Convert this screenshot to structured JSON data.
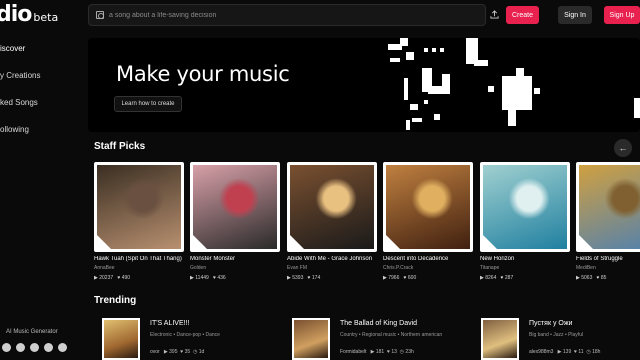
{
  "app": {
    "logo": "dio",
    "beta": "beta"
  },
  "sidebar": {
    "items": [
      {
        "label": "iscover"
      },
      {
        "label": "y Creations"
      },
      {
        "label": "ked Songs"
      },
      {
        "label": "ollowing"
      }
    ],
    "footer": "AI Music Generator",
    "socials": [
      "instagram-icon",
      "discord-icon",
      "tiktok-icon",
      "twitter-icon",
      "youtube-icon"
    ]
  },
  "topbar": {
    "search_placeholder": "a song about a life-saving decision",
    "create": "Create",
    "signin": "Sign In",
    "signup": "Sign Up"
  },
  "hero": {
    "title": "Make your music",
    "button": "Learn how to create"
  },
  "staff_picks": {
    "title": "Staff Picks",
    "cards": [
      {
        "title": "Hawk Tuah (Spit On That Thang)",
        "artist": "AnnaBee",
        "plays": "20237",
        "likes": "490",
        "colors": [
          "#3a2e22",
          "#b89070",
          "#6a5040"
        ]
      },
      {
        "title": "Monster Monster",
        "artist": "Golden",
        "plays": "11449",
        "likes": "436",
        "colors": [
          "#d8a0a8",
          "#2a2a2a",
          "#c04050"
        ]
      },
      {
        "title": "Abide With Me - Grace Johnson",
        "artist": "Evan FM",
        "plays": "5393",
        "likes": "174",
        "colors": [
          "#7a5030",
          "#1a1a1a",
          "#e8c080"
        ]
      },
      {
        "title": "Descent into Decadence",
        "artist": "Chris.P.Crack",
        "plays": "7966",
        "likes": "600",
        "colors": [
          "#c08040",
          "#402010",
          "#e0b060"
        ]
      },
      {
        "title": "New Horizon",
        "artist": "Titanape",
        "plays": "8264",
        "likes": "287",
        "colors": [
          "#a0d0d0",
          "#2080a0",
          "#e0f0f0"
        ]
      },
      {
        "title": "Fields of Struggle",
        "artist": "MediBen",
        "plays": "5063",
        "likes": "85",
        "colors": [
          "#d0a040",
          "#5080b0",
          "#806030"
        ]
      }
    ]
  },
  "trending": {
    "title": "Trending",
    "items": [
      {
        "title": "IT'S ALIVE!!!",
        "tags": [
          "Electronic",
          "Dance-pop",
          "Dance"
        ],
        "artist": "ovor",
        "plays": "395",
        "likes": "35",
        "age": "1d",
        "colors": [
          "#a06830",
          "#e0c070"
        ]
      },
      {
        "title": "The Ballad of King David",
        "tags": [
          "Country",
          "Regional music",
          "Northern american"
        ],
        "artist": "Formidabelt",
        "plays": "181",
        "likes": "13",
        "age": "23h",
        "colors": [
          "#d0a060",
          "#7a5030"
        ]
      },
      {
        "title": "Пустяк у Ожи",
        "tags": [
          "Big band",
          "Jazz",
          "Playful"
        ],
        "artist": "alex988m3",
        "plays": "139",
        "likes": "11",
        "age": "18h",
        "colors": [
          "#e0c080",
          "#806040"
        ]
      }
    ]
  },
  "icons": {
    "search": "search-icon",
    "upload": "upload-icon",
    "play": "▶",
    "heart": "♥",
    "comment": "💬",
    "clock": "◷",
    "arrow": "←"
  }
}
